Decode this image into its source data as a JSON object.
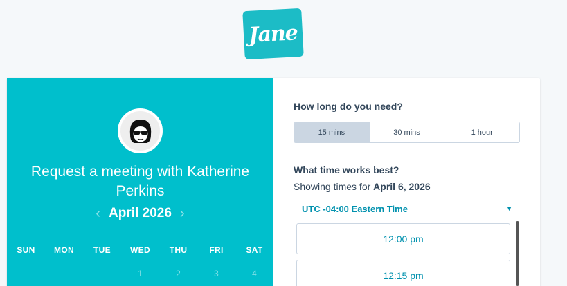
{
  "logo": {
    "text": "Jane"
  },
  "left_panel": {
    "title": "Request a meeting with Katherine Perkins",
    "month": "April 2026",
    "prev_icon": "chevron-left-icon",
    "next_icon": "chevron-right-icon",
    "weekdays": [
      "SUN",
      "MON",
      "TUE",
      "WED",
      "THU",
      "FRI",
      "SAT"
    ],
    "first_week_days": [
      "",
      "",
      "",
      "1",
      "2",
      "3",
      "4"
    ]
  },
  "duration": {
    "question": "How long do you need?",
    "options": [
      "15 mins",
      "30 mins",
      "1 hour"
    ],
    "selected": "15 mins"
  },
  "time": {
    "question": "What time works best?",
    "showing_prefix": "Showing times for ",
    "showing_date": "April 6, 2026",
    "timezone": "UTC -04:00 Eastern Time",
    "slots": [
      "12:00 pm",
      "12:15 pm"
    ]
  },
  "colors": {
    "brand_teal": "#00bfcc",
    "link_blue": "#0091ae",
    "text_dark": "#33475b"
  }
}
